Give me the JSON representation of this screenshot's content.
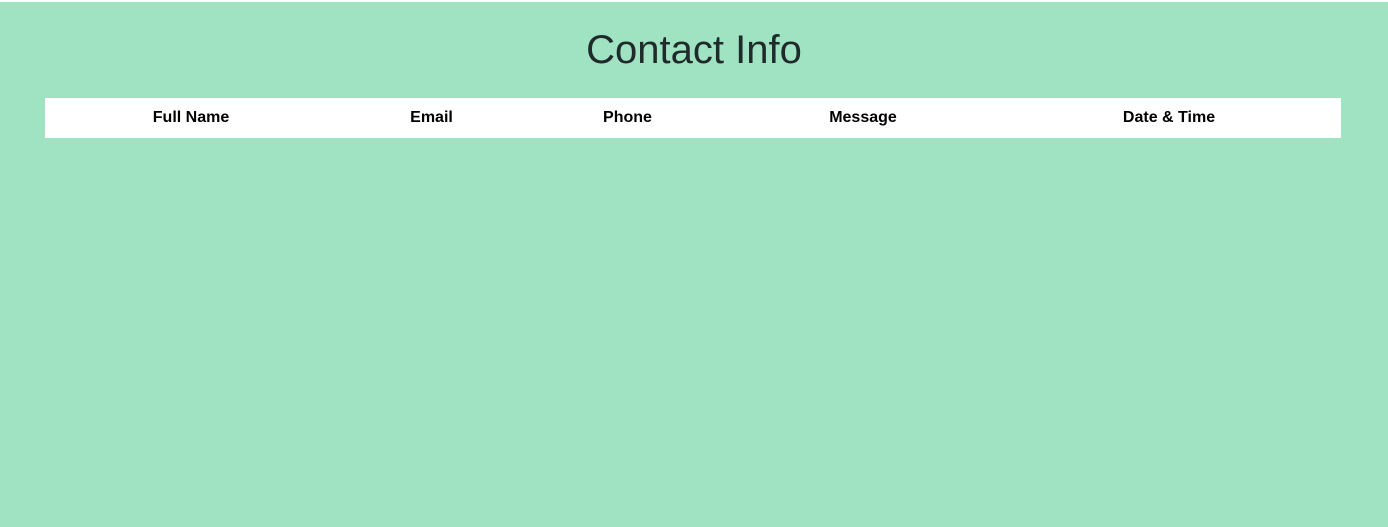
{
  "page": {
    "title": "Contact Info",
    "background_color": "#a0e3c2"
  },
  "table": {
    "headers": [
      "Full Name",
      "Email",
      "Phone",
      "Message",
      "Date & Time"
    ],
    "rows": []
  }
}
